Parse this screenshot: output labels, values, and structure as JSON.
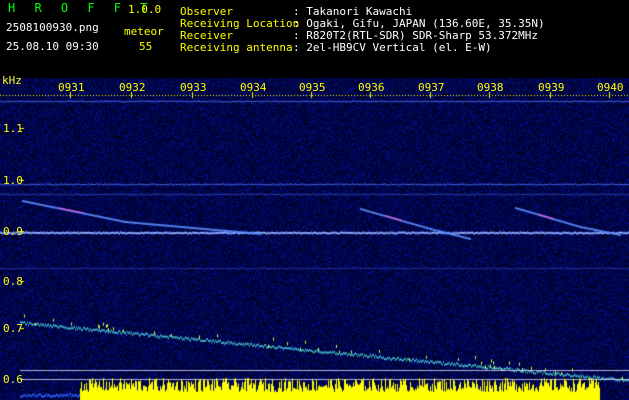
{
  "header": {
    "app_name": "H R O F F T",
    "version": "1.0.0",
    "file_name": "2508100930.png",
    "date_time": "25.08.10 09:30",
    "meteor_label": "meteor",
    "meteor_count": "55",
    "info_labels": [
      "Observer",
      "Receiving Location",
      "Receiver",
      "Receiving antenna"
    ],
    "info_values": [
      ": Takanori Kawachi",
      ": Ogaki, Gifu, JAPAN (136.60E, 35.35N)",
      ": R820T2(RTL-SDR) SDR-Sharp 53.372MHz",
      ": 2el-HB9CV Vertical (el. E-W)"
    ]
  },
  "spectrogram": {
    "unit_label": "kHz",
    "time_labels": [
      "0931",
      "0932",
      "0933",
      "0934",
      "0935",
      "0936",
      "0937",
      "0938",
      "0939",
      "0940"
    ],
    "freq_labels": [
      "1.1",
      "1.0",
      "0.9",
      "0.8",
      "0.7",
      "0.6"
    ],
    "colors": {
      "background": "#000000",
      "noise": "#0a0a6e",
      "band": "#3a50ff",
      "highlight": "#ffff00",
      "white_label": "#ffffff",
      "yellow_label": "#ffff00",
      "green_label": "#00ff00"
    }
  }
}
